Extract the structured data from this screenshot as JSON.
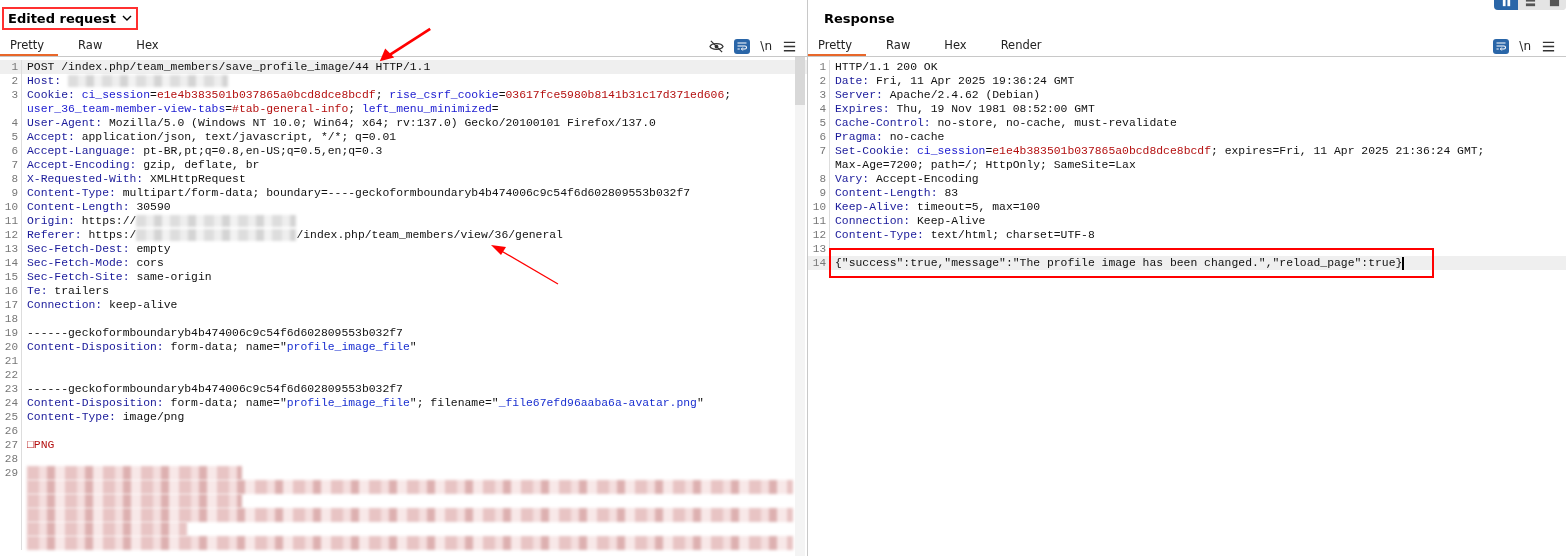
{
  "layout_toggles": [
    {
      "selected": true
    },
    {
      "selected": false
    },
    {
      "selected": false
    }
  ],
  "request": {
    "title": "Edited request",
    "outlined": true,
    "tabs": [
      {
        "label": "Pretty",
        "selected": true
      },
      {
        "label": "Raw",
        "selected": false
      },
      {
        "label": "Hex",
        "selected": false
      }
    ],
    "toolbar": [
      {
        "kind": "hide"
      },
      {
        "kind": "wrap",
        "on": true
      },
      {
        "kind": "text",
        "label": "\\n"
      },
      {
        "kind": "menu"
      }
    ],
    "lines": [
      {
        "number": "1",
        "highlighted": true,
        "rows": [
          {
            "segments": [
              {
                "kind": "plain",
                "text": "POST /index.php/team_members/save_profile_image/44 HTTP/1.1"
              }
            ]
          }
        ]
      },
      {
        "number": "2",
        "rows": [
          {
            "segments": [
              {
                "kind": "key",
                "text": "Host: "
              },
              {
                "kind": "redacted"
              }
            ]
          }
        ]
      },
      {
        "number": "3",
        "rows": [
          {
            "segments": [
              {
                "kind": "key",
                "text": "Cookie: "
              },
              {
                "kind": "name",
                "text": "ci_session"
              },
              {
                "kind": "plain",
                "text": "="
              },
              {
                "kind": "value",
                "text": "e1e4b383501b037865a0bcd8dce8bcdf"
              },
              {
                "kind": "plain",
                "text": "; "
              },
              {
                "kind": "name",
                "text": "rise_csrf_cookie"
              },
              {
                "kind": "plain",
                "text": "="
              },
              {
                "kind": "value",
                "text": "03617fce5980b8141b31c17d371ed606"
              },
              {
                "kind": "plain",
                "text": ";"
              }
            ]
          },
          {
            "segments": [
              {
                "kind": "name",
                "text": "user_36_team-member-view-tabs"
              },
              {
                "kind": "plain",
                "text": "="
              },
              {
                "kind": "value",
                "text": "#tab-general-info"
              },
              {
                "kind": "plain",
                "text": "; "
              },
              {
                "kind": "name",
                "text": "left_menu_minimized"
              },
              {
                "kind": "plain",
                "text": "="
              }
            ]
          }
        ]
      },
      {
        "number": "4",
        "rows": [
          {
            "segments": [
              {
                "kind": "key",
                "text": "User-Agent:"
              },
              {
                "kind": "plain",
                "text": " Mozilla/5.0 (Windows NT 10.0; Win64; x64; rv:137.0) Gecko/20100101 Firefox/137.0"
              }
            ]
          }
        ]
      },
      {
        "number": "5",
        "rows": [
          {
            "segments": [
              {
                "kind": "key",
                "text": "Accept:"
              },
              {
                "kind": "plain",
                "text": " application/json, text/javascript, */*; q=0.01"
              }
            ]
          }
        ]
      },
      {
        "number": "6",
        "rows": [
          {
            "segments": [
              {
                "kind": "key",
                "text": "Accept-Language:"
              },
              {
                "kind": "plain",
                "text": " pt-BR,pt;q=0.8,en-US;q=0.5,en;q=0.3"
              }
            ]
          }
        ]
      },
      {
        "number": "7",
        "rows": [
          {
            "segments": [
              {
                "kind": "key",
                "text": "Accept-Encoding:"
              },
              {
                "kind": "plain",
                "text": " gzip, deflate, br"
              }
            ]
          }
        ]
      },
      {
        "number": "8",
        "rows": [
          {
            "segments": [
              {
                "kind": "key",
                "text": "X-Requested-With:"
              },
              {
                "kind": "plain",
                "text": " XMLHttpRequest"
              }
            ]
          }
        ]
      },
      {
        "number": "9",
        "rows": [
          {
            "segments": [
              {
                "kind": "key",
                "text": "Content-Type:"
              },
              {
                "kind": "plain",
                "text": " multipart/form-data; boundary=----geckoformboundaryb4b474006c9c54f6d602809553b032f7"
              }
            ]
          }
        ]
      },
      {
        "number": "10",
        "rows": [
          {
            "segments": [
              {
                "kind": "key",
                "text": "Content-Length:"
              },
              {
                "kind": "plain",
                "text": " 30590"
              }
            ]
          }
        ]
      },
      {
        "number": "11",
        "rows": [
          {
            "segments": [
              {
                "kind": "key",
                "text": "Origin:"
              },
              {
                "kind": "plain",
                "text": " https://"
              },
              {
                "kind": "redacted"
              }
            ]
          }
        ]
      },
      {
        "number": "12",
        "rows": [
          {
            "segments": [
              {
                "kind": "key",
                "text": "Referer:"
              },
              {
                "kind": "plain",
                "text": " https:/"
              },
              {
                "kind": "redacted"
              },
              {
                "kind": "plain",
                "text": "/index.php/team_members/view/36/general"
              }
            ]
          }
        ]
      },
      {
        "number": "13",
        "rows": [
          {
            "segments": [
              {
                "kind": "key",
                "text": "Sec-Fetch-Dest:"
              },
              {
                "kind": "plain",
                "text": " empty"
              }
            ]
          }
        ]
      },
      {
        "number": "14",
        "rows": [
          {
            "segments": [
              {
                "kind": "key",
                "text": "Sec-Fetch-Mode:"
              },
              {
                "kind": "plain",
                "text": " cors"
              }
            ]
          }
        ]
      },
      {
        "number": "15",
        "rows": [
          {
            "segments": [
              {
                "kind": "key",
                "text": "Sec-Fetch-Site:"
              },
              {
                "kind": "plain",
                "text": " same-origin"
              }
            ]
          }
        ]
      },
      {
        "number": "16",
        "rows": [
          {
            "segments": [
              {
                "kind": "key",
                "text": "Te:"
              },
              {
                "kind": "plain",
                "text": " trailers"
              }
            ]
          }
        ]
      },
      {
        "number": "17",
        "rows": [
          {
            "segments": [
              {
                "kind": "key",
                "text": "Connection:"
              },
              {
                "kind": "plain",
                "text": " keep-alive"
              }
            ]
          }
        ]
      },
      {
        "number": "18"
      },
      {
        "number": "19",
        "rows": [
          {
            "segments": [
              {
                "kind": "plain",
                "text": "------geckoformboundaryb4b474006c9c54f6d602809553b032f7"
              }
            ]
          }
        ]
      },
      {
        "number": "20",
        "rows": [
          {
            "segments": [
              {
                "kind": "key",
                "text": "Content-Disposition:"
              },
              {
                "kind": "plain",
                "text": " form-data; name=\""
              },
              {
                "kind": "string",
                "text": "profile_image_file"
              },
              {
                "kind": "plain",
                "text": "\""
              }
            ]
          }
        ]
      },
      {
        "number": "21"
      },
      {
        "number": "22"
      },
      {
        "number": "23",
        "rows": [
          {
            "segments": [
              {
                "kind": "plain",
                "text": "------geckoformboundaryb4b474006c9c54f6d602809553b032f7"
              }
            ]
          }
        ]
      },
      {
        "number": "24",
        "rows": [
          {
            "segments": [
              {
                "kind": "key",
                "text": "Content-Disposition:"
              },
              {
                "kind": "plain",
                "text": " form-data; name=\""
              },
              {
                "kind": "string",
                "text": "profile_image_file"
              },
              {
                "kind": "plain",
                "text": "\"; filename=\""
              },
              {
                "kind": "string",
                "text": "_file67efd96aaba6a-avatar.png"
              },
              {
                "kind": "plain",
                "text": "\""
              }
            ]
          }
        ]
      },
      {
        "number": "25",
        "rows": [
          {
            "segments": [
              {
                "kind": "key",
                "text": "Content-Type:"
              },
              {
                "kind": "plain",
                "text": " image/png"
              }
            ]
          }
        ]
      },
      {
        "number": "26"
      },
      {
        "number": "27",
        "rows": [
          {
            "segments": [
              {
                "kind": "value",
                "text": "□PNG"
              }
            ]
          }
        ]
      },
      {
        "number": "28"
      },
      {
        "number": "29",
        "rows": [
          {
            "segments": [
              {
                "kind": "redacted"
              }
            ]
          },
          {
            "segments": [
              {
                "kind": "redacted"
              }
            ]
          },
          {
            "segments": [
              {
                "kind": "redacted"
              }
            ]
          },
          {
            "segments": [
              {
                "kind": "redacted"
              }
            ]
          },
          {
            "segments": [
              {
                "kind": "redacted"
              }
            ]
          },
          {
            "segments": [
              {
                "kind": "redacted"
              }
            ]
          }
        ]
      }
    ]
  },
  "response": {
    "title": "Response",
    "outlined": false,
    "tabs": [
      {
        "label": "Pretty",
        "selected": true
      },
      {
        "label": "Raw",
        "selected": false
      },
      {
        "label": "Hex",
        "selected": false
      },
      {
        "label": "Render",
        "selected": false
      }
    ],
    "toolbar": [
      {
        "kind": "wrap",
        "on": true
      },
      {
        "kind": "text",
        "label": "\\n"
      },
      {
        "kind": "menu"
      }
    ],
    "lines": [
      {
        "number": "1",
        "rows": [
          {
            "segments": [
              {
                "kind": "plain",
                "text": "HTTP/1.1 200 OK"
              }
            ]
          }
        ]
      },
      {
        "number": "2",
        "rows": [
          {
            "segments": [
              {
                "kind": "key",
                "text": "Date:"
              },
              {
                "kind": "plain",
                "text": " Fri, 11 Apr 2025 19:36:24 GMT"
              }
            ]
          }
        ]
      },
      {
        "number": "3",
        "rows": [
          {
            "segments": [
              {
                "kind": "key",
                "text": "Server:"
              },
              {
                "kind": "plain",
                "text": " Apache/2.4.62 (Debian)"
              }
            ]
          }
        ]
      },
      {
        "number": "4",
        "rows": [
          {
            "segments": [
              {
                "kind": "key",
                "text": "Expires:"
              },
              {
                "kind": "plain",
                "text": " Thu, 19 Nov 1981 08:52:00 GMT"
              }
            ]
          }
        ]
      },
      {
        "number": "5",
        "rows": [
          {
            "segments": [
              {
                "kind": "key",
                "text": "Cache-Control:"
              },
              {
                "kind": "plain",
                "text": " no-store, no-cache, must-revalidate"
              }
            ]
          }
        ]
      },
      {
        "number": "6",
        "rows": [
          {
            "segments": [
              {
                "kind": "key",
                "text": "Pragma:"
              },
              {
                "kind": "plain",
                "text": " no-cache"
              }
            ]
          }
        ]
      },
      {
        "number": "7",
        "rows": [
          {
            "segments": [
              {
                "kind": "key",
                "text": "Set-Cookie: "
              },
              {
                "kind": "name",
                "text": "ci_session"
              },
              {
                "kind": "plain",
                "text": "="
              },
              {
                "kind": "value",
                "text": "e1e4b383501b037865a0bcd8dce8bcdf"
              },
              {
                "kind": "plain",
                "text": "; expires=Fri, 11 Apr 2025 21:36:24 GMT;"
              }
            ]
          },
          {
            "segments": [
              {
                "kind": "plain",
                "text": "Max-Age=7200; path=/; HttpOnly; SameSite=Lax"
              }
            ]
          }
        ]
      },
      {
        "number": "8",
        "rows": [
          {
            "segments": [
              {
                "kind": "key",
                "text": "Vary:"
              },
              {
                "kind": "plain",
                "text": " Accept-Encoding"
              }
            ]
          }
        ]
      },
      {
        "number": "9",
        "rows": [
          {
            "segments": [
              {
                "kind": "key",
                "text": "Content-Length:"
              },
              {
                "kind": "plain",
                "text": " 83"
              }
            ]
          }
        ]
      },
      {
        "number": "10",
        "rows": [
          {
            "segments": [
              {
                "kind": "key",
                "text": "Keep-Alive:"
              },
              {
                "kind": "plain",
                "text": " timeout=5, max=100"
              }
            ]
          }
        ]
      },
      {
        "number": "11",
        "rows": [
          {
            "segments": [
              {
                "kind": "key",
                "text": "Connection:"
              },
              {
                "kind": "plain",
                "text": " Keep-Alive"
              }
            ]
          }
        ]
      },
      {
        "number": "12",
        "rows": [
          {
            "segments": [
              {
                "kind": "key",
                "text": "Content-Type:"
              },
              {
                "kind": "plain",
                "text": " text/html; charset=UTF-8"
              }
            ]
          }
        ]
      },
      {
        "number": "13"
      },
      {
        "number": "14",
        "highlighted": true,
        "cursor": true,
        "annotated": true,
        "rows": [
          {
            "segments": [
              {
                "kind": "plain",
                "text": "{\"success\":true,\"message\":\"The profile image has been changed.\",\"reload_page\":true}"
              }
            ]
          }
        ]
      }
    ]
  }
}
